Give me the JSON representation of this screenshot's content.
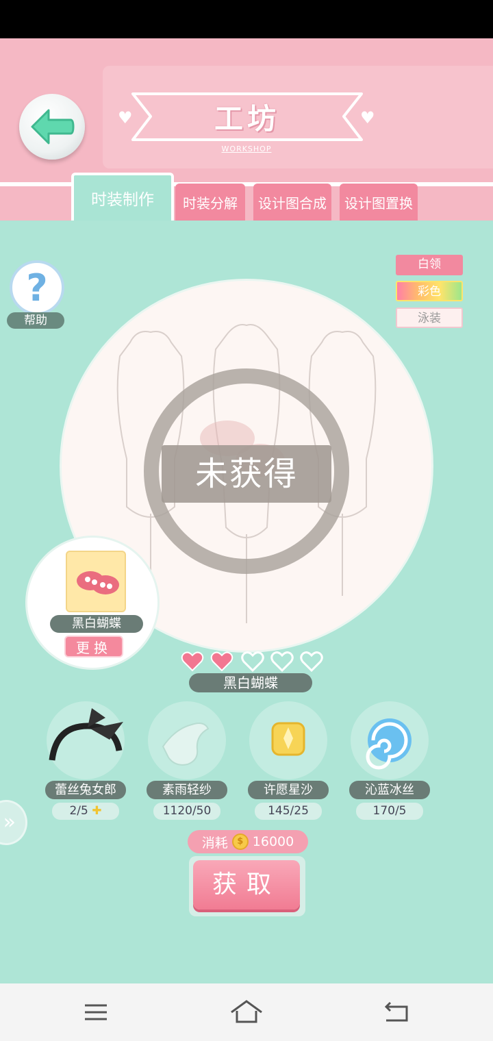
{
  "header": {
    "title": "工坊",
    "subtitle": "WORKSHOP"
  },
  "tabs": [
    {
      "label": "时装制作",
      "active": true
    },
    {
      "label": "时装分解",
      "active": false
    },
    {
      "label": "设计图合成",
      "active": false
    },
    {
      "label": "设计图置换",
      "active": false
    }
  ],
  "help": {
    "label": "帮助"
  },
  "filters": [
    {
      "label": "白领"
    },
    {
      "label": "彩色"
    },
    {
      "label": "泳装"
    }
  ],
  "stage": {
    "status": "未获得"
  },
  "design": {
    "name": "黑白蝴蝶",
    "swap_label": "更换"
  },
  "item": {
    "name": "黑白蝴蝶",
    "hearts_filled": 2,
    "hearts_total": 5
  },
  "materials": [
    {
      "name": "蕾丝兔女郎",
      "count": "2/5",
      "icon": "lace-bunny-headband-icon"
    },
    {
      "name": "素雨轻纱",
      "count": "1120/50",
      "icon": "gauze-fabric-icon"
    },
    {
      "name": "许愿星沙",
      "count": "145/25",
      "icon": "star-sand-gem-icon"
    },
    {
      "name": "沁蓝冰丝",
      "count": "170/5",
      "icon": "blue-ice-silk-icon"
    }
  ],
  "cost": {
    "label": "消耗",
    "amount": "16000"
  },
  "obtain": {
    "label": "获取"
  },
  "colors": {
    "pink": "#f2899f",
    "mint": "#aee5d6",
    "active_tab": "#a9e4d4"
  }
}
